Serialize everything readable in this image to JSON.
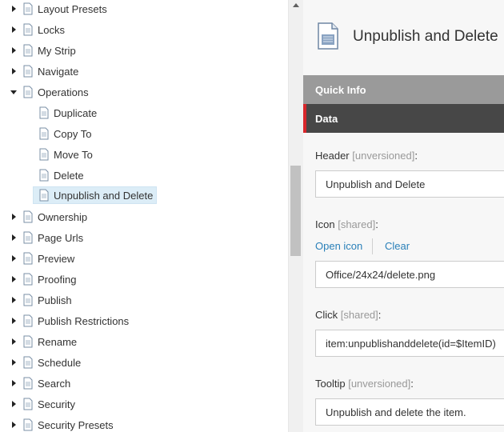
{
  "tree": {
    "items": [
      {
        "label": "Layout Presets",
        "expanded": false
      },
      {
        "label": "Locks",
        "expanded": false
      },
      {
        "label": "My Strip",
        "expanded": false
      },
      {
        "label": "Navigate",
        "expanded": false
      },
      {
        "label": "Operations",
        "expanded": true
      },
      {
        "label": "Duplicate",
        "child": true
      },
      {
        "label": "Copy To",
        "child": true
      },
      {
        "label": "Move To",
        "child": true
      },
      {
        "label": "Delete",
        "child": true
      },
      {
        "label": "Unpublish and Delete",
        "child": true,
        "selected": true
      },
      {
        "label": "Ownership",
        "expanded": false
      },
      {
        "label": "Page Urls",
        "expanded": false
      },
      {
        "label": "Preview",
        "expanded": false
      },
      {
        "label": "Proofing",
        "expanded": false
      },
      {
        "label": "Publish",
        "expanded": false
      },
      {
        "label": "Publish Restrictions",
        "expanded": false
      },
      {
        "label": "Rename",
        "expanded": false
      },
      {
        "label": "Schedule",
        "expanded": false
      },
      {
        "label": "Search",
        "expanded": false
      },
      {
        "label": "Security",
        "expanded": false
      },
      {
        "label": "Security Presets",
        "expanded": false
      }
    ]
  },
  "editor": {
    "title": "Unpublish and Delete",
    "sections": {
      "quick_info": "Quick Info",
      "data": "Data"
    },
    "fields": {
      "header": {
        "label": "Header",
        "tag": "[unversioned]",
        "suffix": ":",
        "value": "Unpublish and Delete"
      },
      "icon": {
        "label": "Icon",
        "tag": "[shared]",
        "suffix": ":",
        "value": "Office/24x24/delete.png",
        "open_link": "Open icon",
        "clear_link": "Clear"
      },
      "click": {
        "label": "Click",
        "tag": "[shared]",
        "suffix": ":",
        "value": "item:unpublishanddelete(id=$ItemID)"
      },
      "tooltip": {
        "label": "Tooltip",
        "tag": "[unversioned]",
        "suffix": ":",
        "value": "Unpublish and delete the item."
      }
    }
  },
  "colors": {
    "accent": "#d8262b",
    "link": "#2a80b9",
    "section_dark": "#474747",
    "section_light": "#9a9a9a",
    "selection": "#dcedf7"
  },
  "icons": {
    "tree_item": "document-icon",
    "collapsed": "chevron-right-icon",
    "expanded": "chevron-down-icon"
  }
}
